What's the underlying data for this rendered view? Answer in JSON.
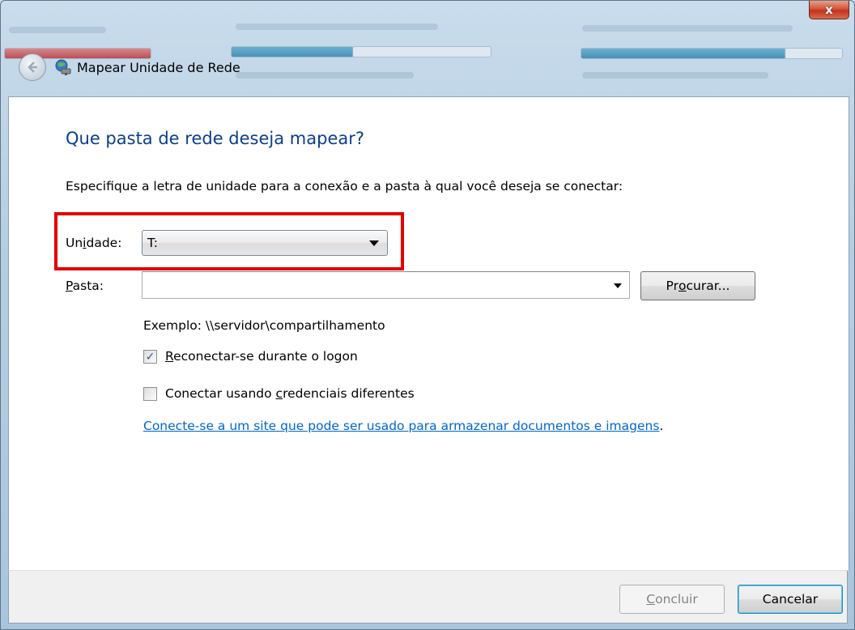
{
  "window": {
    "title": "Mapear Unidade de Rede",
    "close_glyph": "x"
  },
  "icons": {
    "back": "back-arrow-icon",
    "network_drive": "network-drive-icon",
    "close": "close-icon",
    "dropdown": "chevron-down-icon",
    "check": "checkmark-icon"
  },
  "colors": {
    "heading": "#0d3d8e",
    "link": "#0066cc",
    "highlight": "#e20000"
  },
  "main": {
    "heading": "Que pasta de rede deseja mapear?",
    "instruction": "Especifique a letra de unidade para a conexão e a pasta à qual você deseja se conectar:",
    "drive": {
      "label_pre": "Un",
      "label_acc": "i",
      "label_post": "dade:",
      "selected": "T:"
    },
    "folder": {
      "label_acc": "P",
      "label_post": "asta:",
      "value": "",
      "browse_pre": "Pr",
      "browse_acc": "o",
      "browse_post": "curar..."
    },
    "example": "Exemplo: \\\\servidor\\compartilhamento",
    "reconnect": {
      "checked": true,
      "label_acc": "R",
      "label_post": "econectar-se durante o logon"
    },
    "credentials": {
      "checked": false,
      "label_pre": "Conectar usando ",
      "label_acc": "c",
      "label_post": "redenciais diferentes"
    },
    "link_text": "Conecte-se a um site que pode ser usado para armazenar documentos e imagens",
    "link_suffix": "."
  },
  "footer": {
    "finish_acc": "C",
    "finish_post": "oncluir",
    "cancel": "Cancelar"
  }
}
